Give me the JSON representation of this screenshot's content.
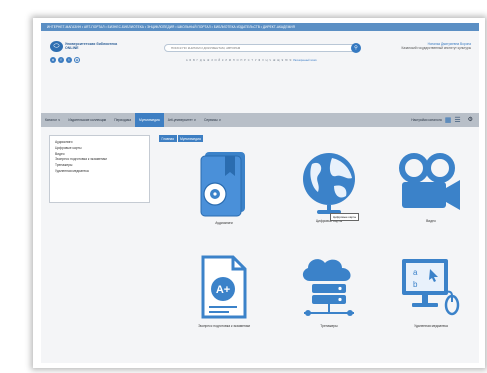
{
  "top_links": "ИНТЕРНЕТ-МАГАЗИН • ART-ПОРТАЛ • БИЗНЕС-БИБЛИОТЕКА • ЭНЦИКЛОПЕДИЯ • ШКОЛЬНЫЙ ПОРТАЛ • БИБЛИОТЕКА ИЗДАТЕЛЬСТВ • ДИРЕКТ-АКАДЕМИЯ",
  "logo": {
    "title": "Университетская библиотека ONLINE"
  },
  "search": {
    "placeholder": "ПОИСК ПО КНИГАМ И ДОКУМЕНТАМ, АВТОРАМ",
    "button_icon": "search-icon"
  },
  "alphabet": "А Б В Г Д Е Ж З И Й К Л М Н О П Р С Т У Ф Х Ц Ч Ш Щ Э Ю Я",
  "advanced_search": "Расширенный поиск",
  "user": {
    "name": "Наталья Дмитриевна Ворона",
    "org": "Казанский государственный институт культуры"
  },
  "nav": {
    "items": [
      "Каталог ∨",
      "Издательские коллекции",
      "Периодика",
      "Мультимедиа",
      "Arti-университет ∨",
      "Сервисы ∨"
    ],
    "active_index": 3,
    "settings_label": "Настройки каталога"
  },
  "sidebar": {
    "items": [
      "Аудиокниги",
      "Цифровые карты",
      "Видео",
      "Экспресс подготовка к экзаменам",
      "Тренажеры",
      "Удаленная медиатека"
    ]
  },
  "breadcrumb": [
    "Главная",
    "Мультимедиа"
  ],
  "tiles": {
    "audiobooks": "Аудиокниги",
    "maps": "Цифровые карты",
    "video": "Видео",
    "exam": "Экспресс подготовка к экзаменам",
    "trainers": "Тренажеры",
    "mediatheque": "Удаленная медиатека"
  },
  "tooltip": "Цифровые карты",
  "colors": {
    "accent": "#3e7fc3",
    "topbar": "#5b8fc4",
    "icon": "#3b82c9",
    "nav": "#b8bfc8"
  }
}
